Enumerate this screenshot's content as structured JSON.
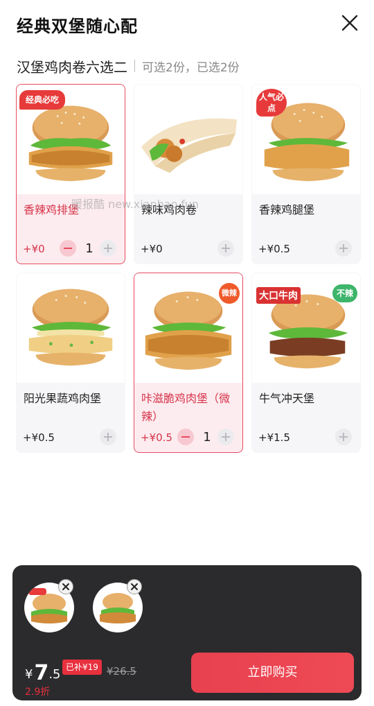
{
  "header": {
    "title": "经典双堡随心配"
  },
  "section": {
    "title": "汉堡鸡肉卷六选二",
    "info": "可选2份，已选2份"
  },
  "products": [
    {
      "name": "香辣鸡排堡",
      "price": "+¥0",
      "selected": true,
      "qty": "1",
      "badge": "经典必吃"
    },
    {
      "name": "辣味鸡肉卷",
      "price": "+¥0",
      "selected": false
    },
    {
      "name": "香辣鸡腿堡",
      "price": "+¥0.5",
      "selected": false,
      "badge": "人气必点"
    },
    {
      "name": "阳光果蔬鸡肉堡",
      "price": "+¥0.5",
      "selected": false
    },
    {
      "name": "咔滋脆鸡肉堡（微辣）",
      "price": "+¥0.5",
      "selected": true,
      "qty": "1",
      "badge": "微辣"
    },
    {
      "name": "牛气冲天堡",
      "price": "+¥1.5",
      "selected": false,
      "badge": "大口牛肉",
      "badge2": "不辣"
    }
  ],
  "watermark": "暖报酷 new.xianbao.fun",
  "cart": {
    "currency": "¥",
    "price_int": "7",
    "price_dec": ".5",
    "subsidy": "已补¥19",
    "original": "¥26.5",
    "discount": "2.9折",
    "buy_label": "立即购买"
  },
  "colors": {
    "accent": "#e84a5f",
    "dark_bar": "#2b2b2d"
  },
  "icons": {
    "close": "close-icon",
    "plus": "plus-icon",
    "minus": "minus-icon",
    "remove": "remove-icon"
  }
}
